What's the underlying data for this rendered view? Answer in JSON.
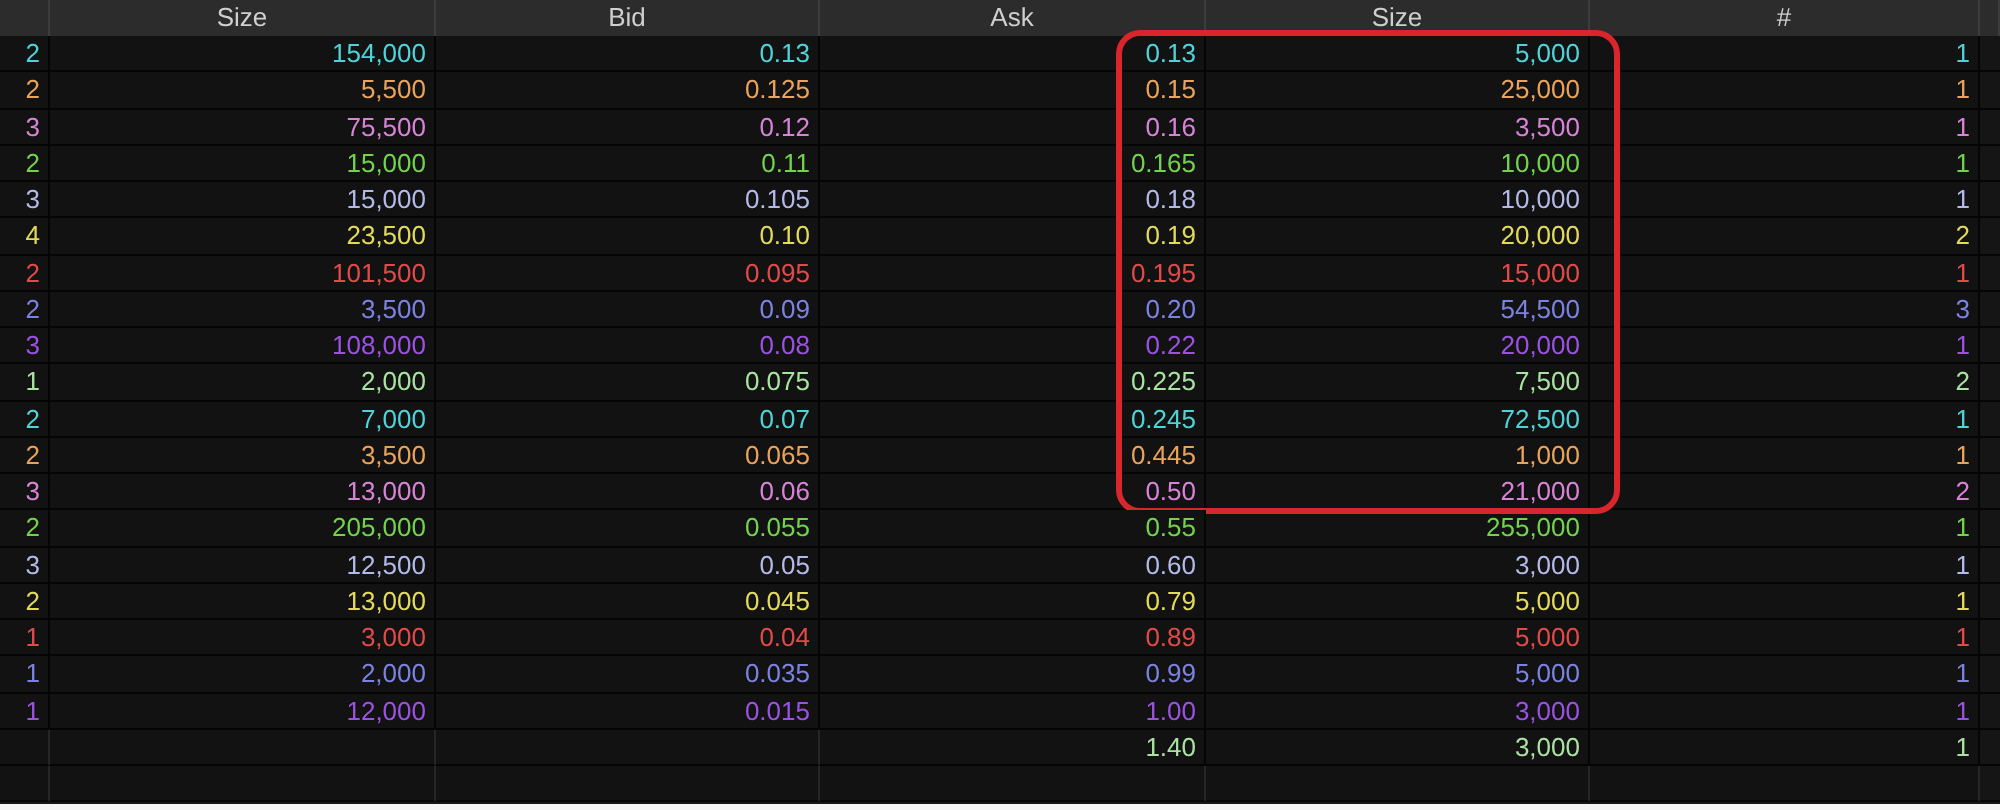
{
  "columns": [
    "Size",
    "Bid",
    "Ask",
    "Size",
    "#"
  ],
  "rows": [
    {
      "bid": {
        "count": "2",
        "size": "154,000",
        "price": "0.13",
        "color": "#4fd3d9"
      },
      "ask": {
        "price": "0.13",
        "size": "5,000",
        "count": "1",
        "color": "#4fd3d9",
        "highlighted": true
      }
    },
    {
      "bid": {
        "count": "2",
        "size": "5,500",
        "price": "0.125",
        "color": "#e9a35a"
      },
      "ask": {
        "price": "0.15",
        "size": "25,000",
        "count": "1",
        "color": "#e9a35a",
        "highlighted": true
      }
    },
    {
      "bid": {
        "count": "3",
        "size": "75,500",
        "price": "0.12",
        "color": "#d983d8"
      },
      "ask": {
        "price": "0.16",
        "size": "3,500",
        "count": "1",
        "color": "#d983d8",
        "highlighted": true
      }
    },
    {
      "bid": {
        "count": "2",
        "size": "15,000",
        "price": "0.11",
        "color": "#72d34c"
      },
      "ask": {
        "price": "0.165",
        "size": "10,000",
        "count": "1",
        "color": "#72d34c",
        "highlighted": true
      }
    },
    {
      "bid": {
        "count": "3",
        "size": "15,000",
        "price": "0.105",
        "color": "#b3bae9"
      },
      "ask": {
        "price": "0.18",
        "size": "10,000",
        "count": "1",
        "color": "#b3bae9",
        "highlighted": true
      }
    },
    {
      "bid": {
        "count": "4",
        "size": "23,500",
        "price": "0.10",
        "color": "#e3da5c"
      },
      "ask": {
        "price": "0.19",
        "size": "20,000",
        "count": "2",
        "color": "#e3da5c",
        "highlighted": true
      }
    },
    {
      "bid": {
        "count": "2",
        "size": "101,500",
        "price": "0.095",
        "color": "#e24a4a"
      },
      "ask": {
        "price": "0.195",
        "size": "15,000",
        "count": "1",
        "color": "#e24a4a",
        "highlighted": true
      }
    },
    {
      "bid": {
        "count": "2",
        "size": "3,500",
        "price": "0.09",
        "color": "#7c82e2"
      },
      "ask": {
        "price": "0.20",
        "size": "54,500",
        "count": "3",
        "color": "#7c82e2",
        "highlighted": true
      }
    },
    {
      "bid": {
        "count": "3",
        "size": "108,000",
        "price": "0.08",
        "color": "#9b52e2"
      },
      "ask": {
        "price": "0.22",
        "size": "20,000",
        "count": "1",
        "color": "#9b52e2",
        "highlighted": true
      }
    },
    {
      "bid": {
        "count": "1",
        "size": "2,000",
        "price": "0.075",
        "color": "#a9e2a2"
      },
      "ask": {
        "price": "0.225",
        "size": "7,500",
        "count": "2",
        "color": "#a9e2a2",
        "highlighted": true
      }
    },
    {
      "bid": {
        "count": "2",
        "size": "7,000",
        "price": "0.07",
        "color": "#4fd3d9"
      },
      "ask": {
        "price": "0.245",
        "size": "72,500",
        "count": "1",
        "color": "#4fd3d9",
        "highlighted": true
      }
    },
    {
      "bid": {
        "count": "2",
        "size": "3,500",
        "price": "0.065",
        "color": "#e9a35a"
      },
      "ask": {
        "price": "0.445",
        "size": "1,000",
        "count": "1",
        "color": "#e9a35a",
        "highlighted": true
      }
    },
    {
      "bid": {
        "count": "3",
        "size": "13,000",
        "price": "0.06",
        "color": "#d983d8"
      },
      "ask": {
        "price": "0.50",
        "size": "21,000",
        "count": "2",
        "color": "#d983d8",
        "highlighted": true
      }
    },
    {
      "bid": {
        "count": "2",
        "size": "205,000",
        "price": "0.055",
        "color": "#72d34c"
      },
      "ask": {
        "price": "0.55",
        "size": "255,000",
        "count": "1",
        "color": "#72d34c",
        "highlighted": false
      }
    },
    {
      "bid": {
        "count": "3",
        "size": "12,500",
        "price": "0.05",
        "color": "#b3bae9"
      },
      "ask": {
        "price": "0.60",
        "size": "3,000",
        "count": "1",
        "color": "#b3bae9",
        "highlighted": false
      }
    },
    {
      "bid": {
        "count": "2",
        "size": "13,000",
        "price": "0.045",
        "color": "#e3da5c"
      },
      "ask": {
        "price": "0.79",
        "size": "5,000",
        "count": "1",
        "color": "#e3da5c",
        "highlighted": false
      }
    },
    {
      "bid": {
        "count": "1",
        "size": "3,000",
        "price": "0.04",
        "color": "#e24a4a"
      },
      "ask": {
        "price": "0.89",
        "size": "5,000",
        "count": "1",
        "color": "#e24a4a",
        "highlighted": false
      }
    },
    {
      "bid": {
        "count": "1",
        "size": "2,000",
        "price": "0.035",
        "color": "#7c82e2"
      },
      "ask": {
        "price": "0.99",
        "size": "5,000",
        "count": "1",
        "color": "#7c82e2",
        "highlighted": false
      }
    },
    {
      "bid": {
        "count": "1",
        "size": "12,000",
        "price": "0.015",
        "color": "#9b52e2"
      },
      "ask": {
        "price": "1.00",
        "size": "3,000",
        "count": "1",
        "color": "#9b52e2",
        "highlighted": false
      }
    },
    {
      "ask": {
        "price": "1.40",
        "size": "3,000",
        "count": "1",
        "color": "#a9e2a2",
        "highlighted": false
      }
    }
  ]
}
